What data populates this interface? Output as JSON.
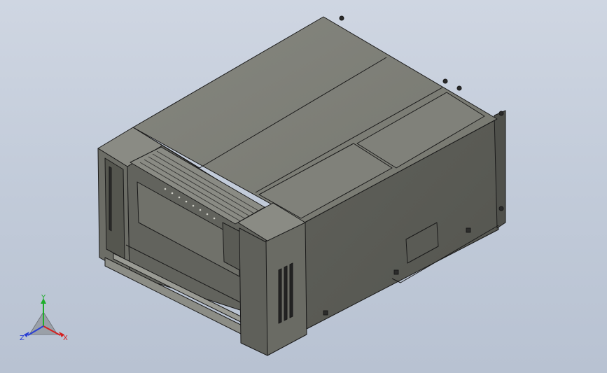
{
  "viewport": {
    "background_top": "#cfd6e2",
    "background_bottom": "#b8c2d2"
  },
  "model": {
    "edge_color": "#1a1a1a",
    "top_color": "#7e7f78",
    "side_color": "#5d5e58",
    "front_color": "#6b6c65"
  },
  "triad": {
    "x_label": "X",
    "y_label": "Y",
    "z_label": "Z",
    "x_color": "#d42020",
    "y_color": "#1fae2c",
    "z_color": "#2a3fd4"
  }
}
